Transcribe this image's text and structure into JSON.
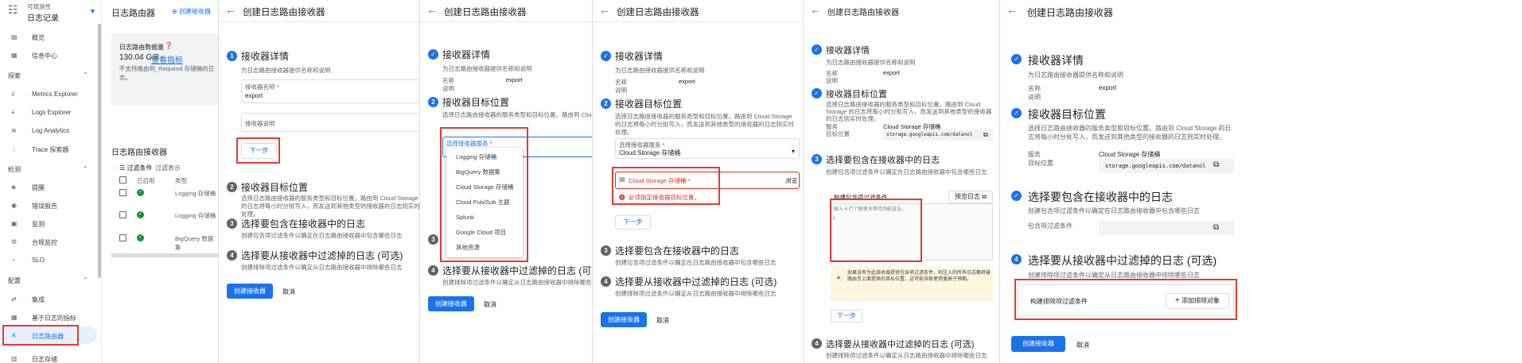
{
  "sidebar": {
    "product_line1": "可观测性",
    "product_line2": "日志记录",
    "items": [
      {
        "label": "概览",
        "icon": "dashboard-icon",
        "glyph": "▤"
      },
      {
        "label": "信息中心",
        "icon": "grid-icon",
        "glyph": "▦"
      }
    ],
    "explore_section": "探索",
    "explore_items": [
      {
        "label": "Metrics Explorer",
        "glyph": "ıl"
      },
      {
        "label": "Logs Explorer",
        "glyph": "≡"
      },
      {
        "label": "Log Analytics",
        "glyph": "≋"
      },
      {
        "label": "Trace 探索器",
        "glyph": "⋮"
      }
    ],
    "detect_section": "检测",
    "detect_items": [
      {
        "label": "提醒",
        "glyph": "🔔"
      },
      {
        "label": "错误报告",
        "glyph": "◉"
      },
      {
        "label": "监测",
        "glyph": "▣"
      },
      {
        "label": "合规监控",
        "glyph": "⚙"
      },
      {
        "label": "SLO",
        "glyph": "◔"
      }
    ],
    "config_section": "配置",
    "config_items": [
      {
        "label": "集成",
        "glyph": "⇄"
      },
      {
        "label": "基于日志的指标",
        "glyph": "▦"
      },
      {
        "label": "日志路由器",
        "glyph": "✕"
      },
      {
        "label": "日志存储",
        "glyph": "▥"
      }
    ]
  },
  "router": {
    "title": "日志路由器",
    "create_label": "创建接收器",
    "volume_label": "日志路由数据量",
    "volume_value": "130.04 GiB",
    "volume_link": "查看指标",
    "volume_note": "不支持路由到_Required 存储桶的日志。",
    "sinks_title": "日志路由接收器",
    "filter_label": "过滤条件",
    "filter_placeholder": "过滤表示",
    "col_enabled": "已启用",
    "col_type": "类型",
    "rows": [
      {
        "type": "Logging 存储桶"
      },
      {
        "type": "Logging 存储桶"
      },
      {
        "type": "BigQuery 数据集"
      }
    ]
  },
  "wizard": {
    "page_title": "创建日志路由接收器",
    "step1_title": "接收器详情",
    "step1_desc": "为日志路由接收器提供名称和说明",
    "step2_title": "接收器目标位置",
    "step2_desc": "选择日志路由接收器的服务类型和目标位置。路由到 Cloud Storage 的日志将每小时分批写入，而发送到其他类型的接收器的日志则实时处理。",
    "step3_title": "选择要包含在接收器中的日志",
    "step3_desc": "创建包含项过滤条件以确定在日志路由接收器中包含哪些日志",
    "step4_title": "选择要从接收器中过滤掉的日志 (可选)",
    "step4_desc": "创建排除项过滤条件以确定从日志路由接收器中排除哪些日志",
    "name_label": "接收器名称 *",
    "name_value": "export",
    "desc_label": "接收器说明",
    "next_label": "下一步",
    "create_label": "创建接收器",
    "cancel_label": "取消",
    "summary_name_key": "名称",
    "summary_desc_key": "说明",
    "service_label": "选择接收器服务 *",
    "service_value": "Cloud Storage 存储桶",
    "service_options": [
      "Logging 存储桶",
      "BigQuery 数据集",
      "Cloud Storage 存储桶",
      "Cloud Pub/Sub 主题",
      "Splunk",
      "Google Cloud 项目",
      "其他资源"
    ],
    "bucket_label": "Cloud Storage 存储桶 *",
    "bucket_browse": "浏览",
    "bucket_error": "必须指定接收器目标位置。",
    "summary_service_key": "服务",
    "summary_target_key": "目标位置",
    "bucket_path": "storage.googleapis.com/datanol",
    "inclusion_label": "构建包含项过滤条件",
    "inclusion_preview": "预览日志",
    "inclusion_hint": "输入 4 行了解更多等待功能语法。",
    "inclusion_warning": "如果没有为此接收器提供包含项过滤条件，则注入的所有日志都将被路由至上面提供的目标位置，这可能导致使用量高于预期。",
    "inclusion_short": "包含项过滤条件",
    "exclusion_label": "构建排除项过滤条件",
    "add_exclusion": "添加排除对象"
  }
}
